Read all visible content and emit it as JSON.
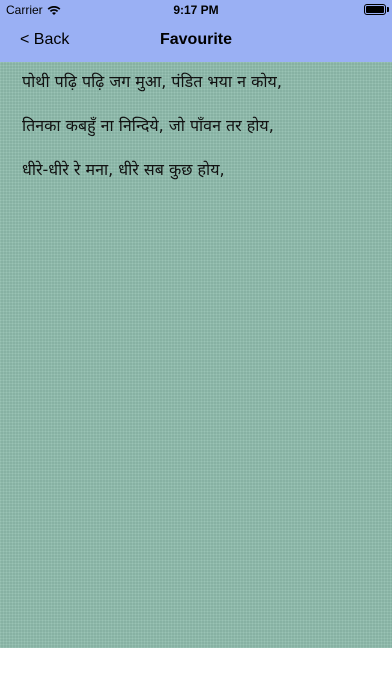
{
  "status_bar": {
    "carrier": "Carrier",
    "time": "9:17 PM",
    "battery_level_percent": 100
  },
  "nav": {
    "back_label": "< Back",
    "title": "Favourite"
  },
  "verse": {
    "lines": [
      "पोथी पढ़ि पढ़ि जग मुआ, पंडित भया न कोय,",
      "तिनका कबहुँ ना निन्दिये, जो पाँवन तर होय,",
      "धीरे-धीरे रे मना, धीरे सब कुछ होय,"
    ]
  },
  "colors": {
    "bar_background": "#9ab0f4",
    "content_background": "#8fbdad"
  }
}
